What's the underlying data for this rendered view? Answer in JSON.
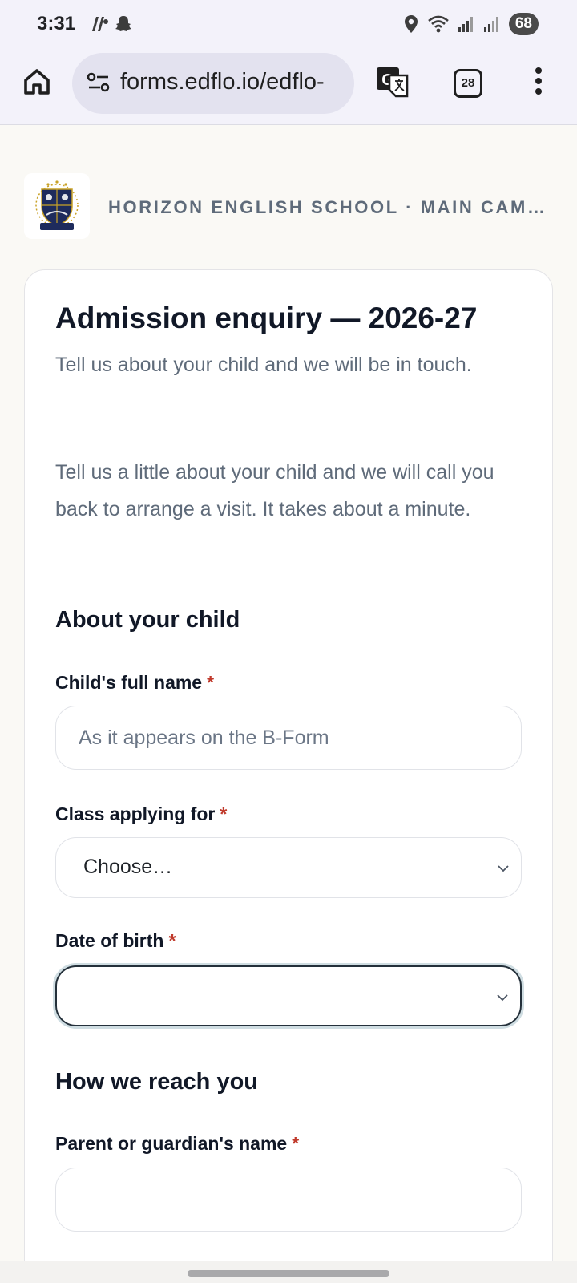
{
  "status_bar": {
    "time": "3:31",
    "left_icons": [
      "notification-icon",
      "snapchat-icon"
    ],
    "right_icons": [
      "location-icon",
      "wifi-icon",
      "signal-icon",
      "signal-icon"
    ],
    "battery": "68"
  },
  "browser": {
    "url": "forms.edflo.io/edflo-",
    "tab_count": "28",
    "icons": [
      "home-icon",
      "site-settings-icon",
      "translate-icon",
      "tabs-icon",
      "more-menu-icon"
    ]
  },
  "school": {
    "name": "HORIZON ENGLISH SCHOOL · MAIN CAM…",
    "logo": "school-crest"
  },
  "form": {
    "title": "Admission enquiry — 2026-27",
    "subtitle": "Tell us about your child and we will be in touch.",
    "description": "Tell us a little about your child and we will call you back to arrange a visit. It takes about a minute.",
    "sections": {
      "child": "About your child",
      "contact": "How we reach you"
    },
    "required_mark": "*",
    "fields": {
      "child_name": {
        "label": "Child's full name",
        "placeholder": "As it appears on the B-Form",
        "value": ""
      },
      "class_applying": {
        "label": "Class applying for",
        "value": "Choose…"
      },
      "date_of_birth": {
        "label": "Date of birth",
        "value": ""
      },
      "guardian_name": {
        "label": "Parent or guardian's name",
        "value": ""
      }
    }
  },
  "colors": {
    "page_background": "#faf9f5",
    "browser_chrome": "#f3f2fa",
    "text_primary": "#111827",
    "text_muted": "#5f6b7a",
    "required": "#c0392b",
    "focus_ring": "#24303a"
  }
}
